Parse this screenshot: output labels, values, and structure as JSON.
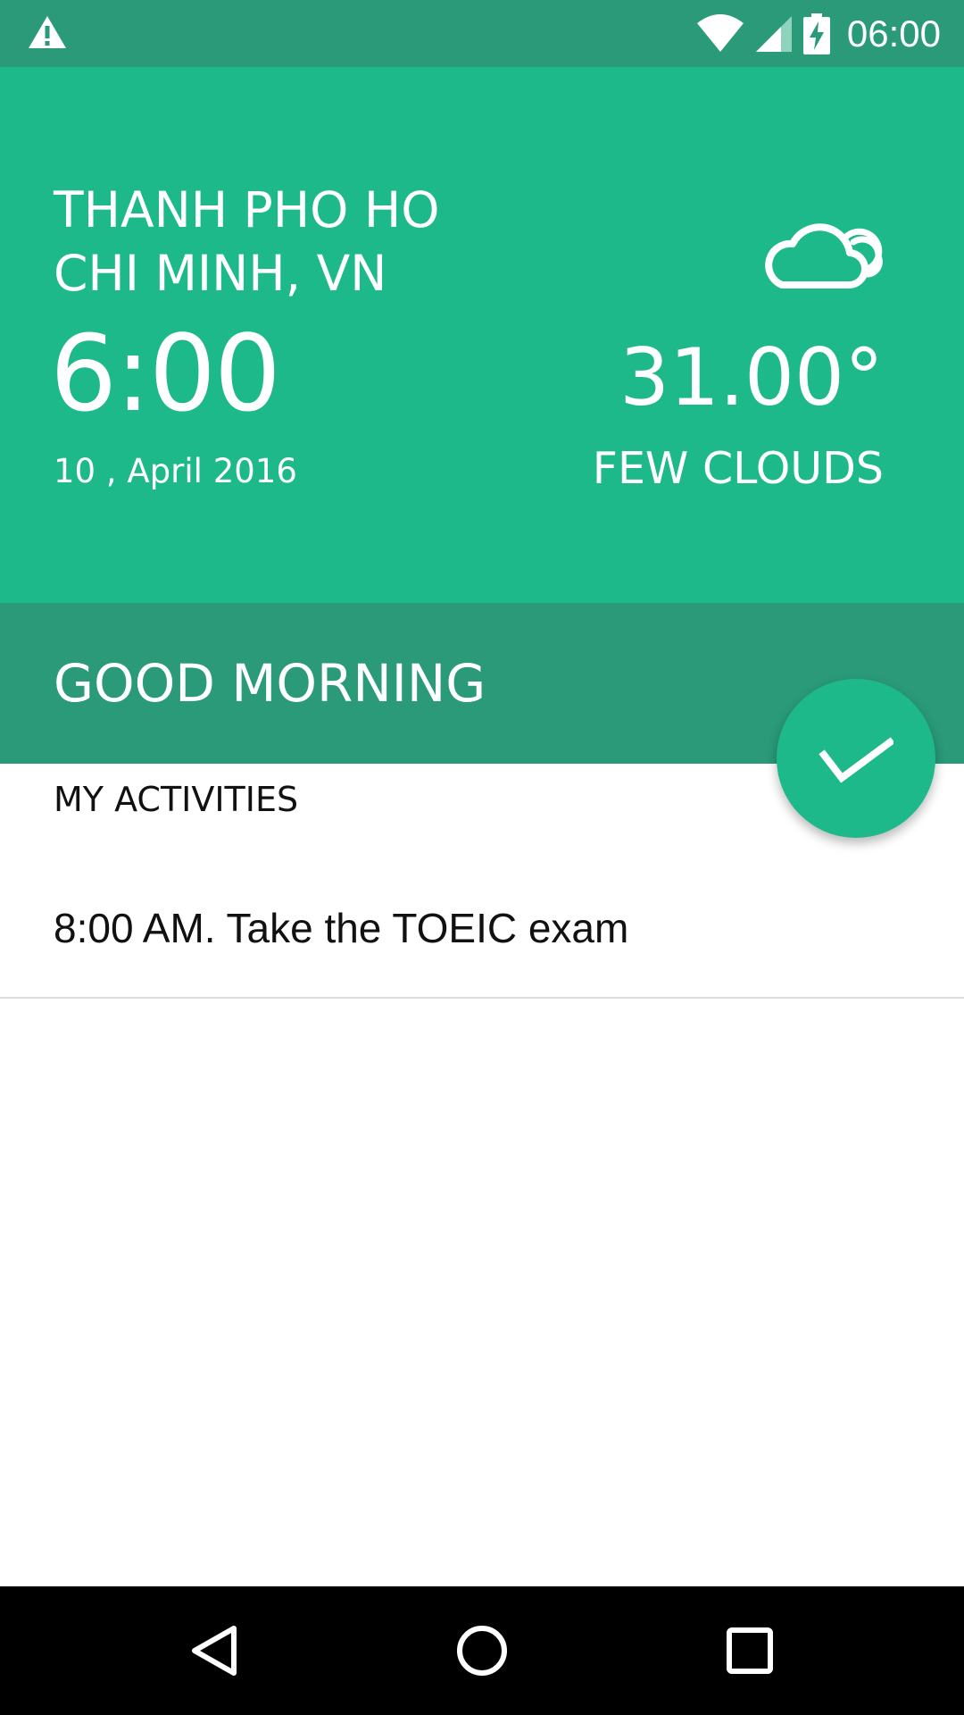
{
  "status_bar": {
    "time": "06:00",
    "icons": [
      "warning-icon",
      "wifi-icon",
      "cellular-signal-icon",
      "battery-charging-icon"
    ]
  },
  "weather": {
    "city": "THANH PHO HO\nCHI MINH, VN",
    "time": "6:00",
    "date": "10 , April 2016",
    "temperature": "31.00°",
    "condition": "FEW CLOUDS",
    "icon": "cloud-icon"
  },
  "greeting": {
    "text": "GOOD MORNING"
  },
  "fab": {
    "icon": "check-icon"
  },
  "activities": {
    "title": "MY ACTIVITIES",
    "items": [
      {
        "text": "8:00 AM. Take the TOEIC exam"
      }
    ]
  },
  "nav_bar": {
    "buttons": [
      "back-icon",
      "home-icon",
      "recents-icon"
    ]
  },
  "colors": {
    "primary": "#1eb98a",
    "primary_dark": "#2a9a79",
    "nav_background": "#000000"
  }
}
